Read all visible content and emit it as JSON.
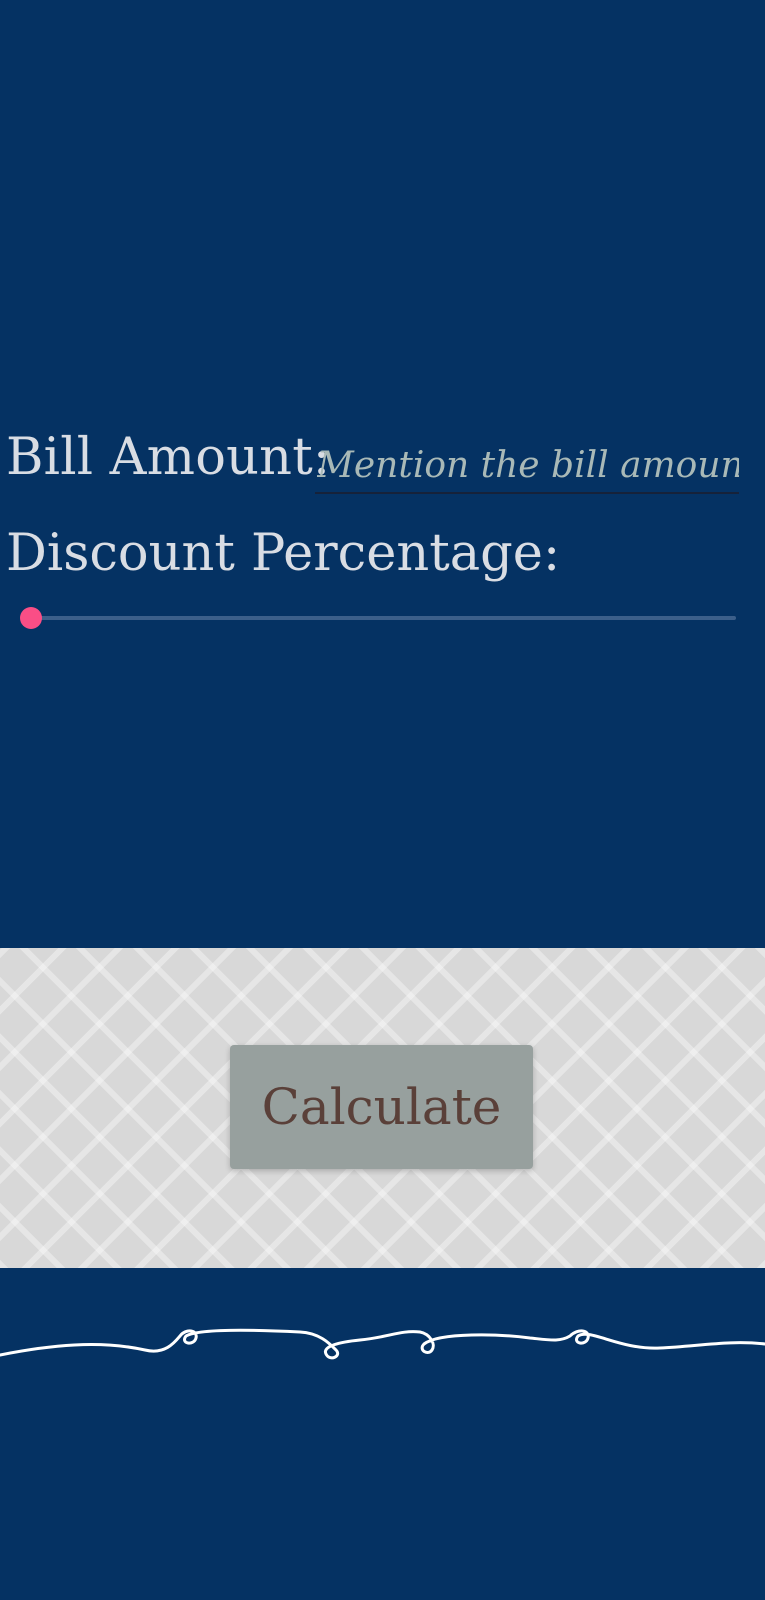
{
  "form": {
    "bill_label": "Bill Amount:",
    "bill_placeholder": "Mention the bill amount",
    "bill_value": "",
    "discount_label": "Discount Percentage:",
    "discount_value_percent": 0
  },
  "actions": {
    "calculate_label": "Calculate"
  },
  "colors": {
    "background": "#053263",
    "label_text": "#d9dde4",
    "slider_thumb": "#fa4e86",
    "slider_track": "#3c5f8a",
    "panel_background": "#d8d8d8",
    "button_background": "#97a09e",
    "button_text": "#5a4039",
    "divider_stroke": "#ffffff"
  },
  "icons": {
    "divider": "swirl-divider-icon"
  }
}
